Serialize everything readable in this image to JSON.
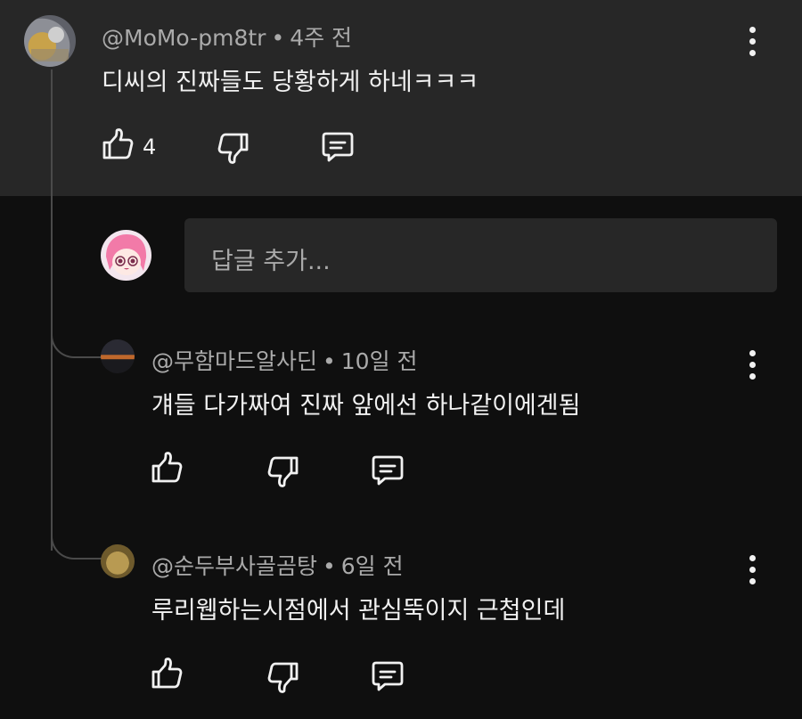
{
  "comment": {
    "author": "@MoMo-pm8tr",
    "time": "4주 전",
    "text": "디씨의 진짜들도 당황하게 하네ㅋㅋㅋ",
    "likes": "4"
  },
  "reply_input": {
    "placeholder": "답글 추가..."
  },
  "replies": [
    {
      "author": "@무함마드알사딘",
      "time": "10일 전",
      "text": "걔들 다가짜여  진짜 앞에선 하나같이에겐됨"
    },
    {
      "author": "@순두부사골곰탕",
      "time": "6일 전",
      "text": "루리웹하는시점에서 관심뚝이지 근첩인데"
    }
  ],
  "separator": "•",
  "icons": [
    "like-icon",
    "dislike-icon",
    "reply-icon",
    "more-vert-icon"
  ]
}
